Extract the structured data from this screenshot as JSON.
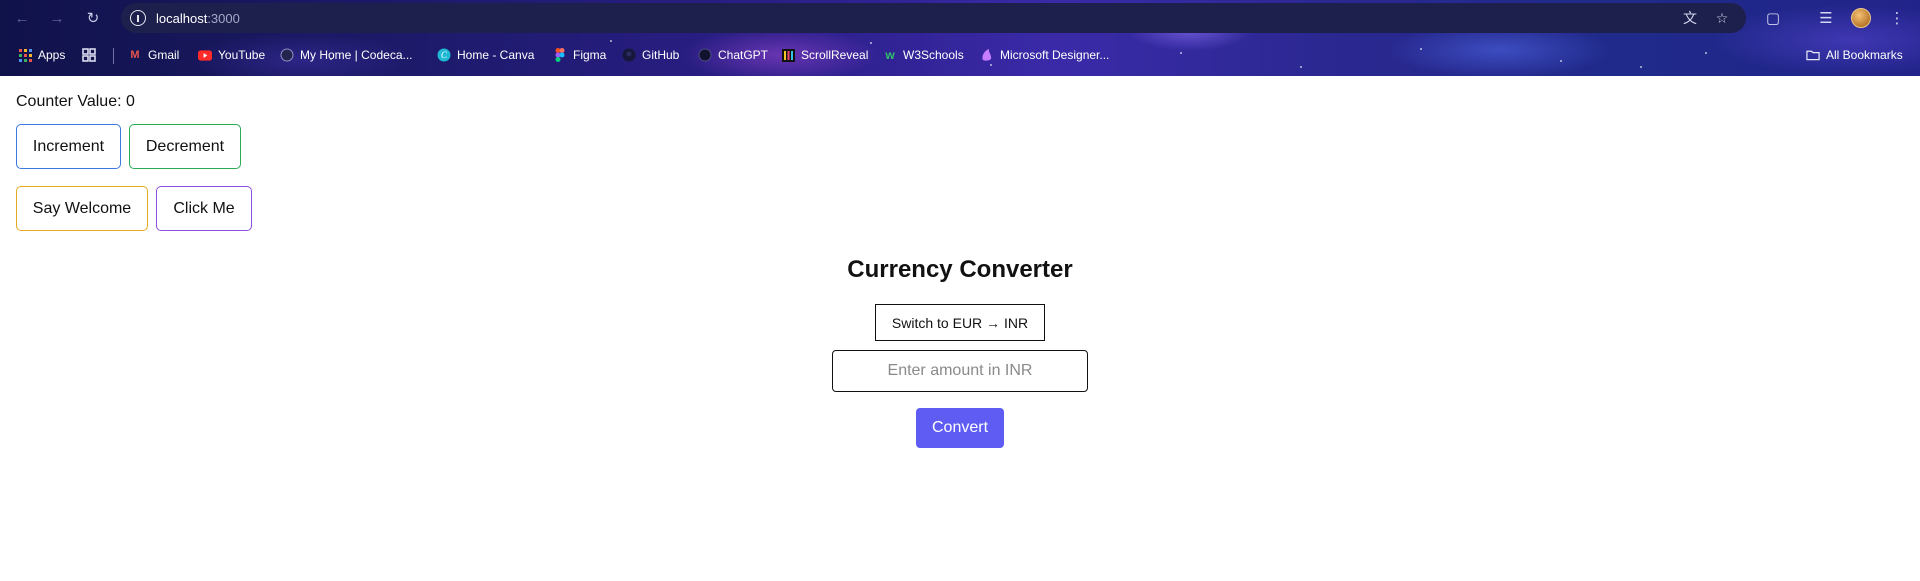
{
  "browser": {
    "url_host": "localhost",
    "url_port": ":3000",
    "all_bookmarks_label": "All Bookmarks",
    "bookmarks": [
      {
        "label": "Apps",
        "icon": "apps-grid-icon"
      },
      {
        "label": "",
        "icon": "grid-squares-icon"
      },
      {
        "label": "Gmail",
        "icon": "gmail-icon"
      },
      {
        "label": "YouTube",
        "icon": "youtube-icon"
      },
      {
        "label": "My Home | Codeca...",
        "icon": "codecademy-icon"
      },
      {
        "label": "Home - Canva",
        "icon": "canva-icon"
      },
      {
        "label": "Figma",
        "icon": "figma-icon"
      },
      {
        "label": "GitHub",
        "icon": "github-icon"
      },
      {
        "label": "ChatGPT",
        "icon": "chatgpt-icon"
      },
      {
        "label": "ScrollReveal",
        "icon": "scrollreveal-icon"
      },
      {
        "label": "W3Schools",
        "icon": "w3schools-icon"
      },
      {
        "label": "Microsoft Designer...",
        "icon": "designer-icon"
      }
    ]
  },
  "counter": {
    "label": "Counter Value: 0",
    "increment_label": "Increment",
    "decrement_label": "Decrement"
  },
  "actions": {
    "welcome_label": "Say Welcome",
    "click_label": "Click Me"
  },
  "converter": {
    "title": "Currency Converter",
    "switch_label": "Switch to EUR → INR",
    "amount_placeholder": "Enter amount in INR",
    "convert_label": "Convert"
  },
  "colors": {
    "increment_border": "#3b78e0",
    "decrement_border": "#2aab55",
    "welcome_border": "#e7a823",
    "click_border": "#8c4fe0",
    "convert_bg": "#5e5cf2"
  }
}
